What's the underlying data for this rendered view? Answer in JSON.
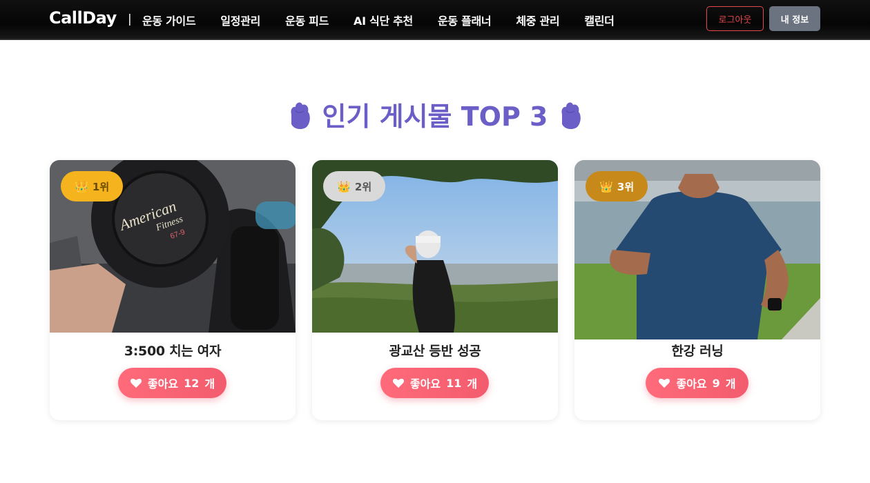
{
  "nav": {
    "brand": "CallDay",
    "separator": "|",
    "items": [
      "운동 가이드",
      "일정관리",
      "운동 피드",
      "AI 식단 추천",
      "운동 플래너",
      "체중 관리",
      "캘린더"
    ],
    "logout": "로그아웃",
    "my_info": "내 정보"
  },
  "section": {
    "title": "인기 게시물 TOP 3",
    "icon_left": "fist-icon",
    "icon_right": "fist-icon"
  },
  "posts": [
    {
      "rank": "1위",
      "badge_color": "#f5b41e",
      "badge_text_color": "#6b4b00",
      "title": "3:500 치는 여자",
      "like_label": "좋아요",
      "likes": "12",
      "like_unit": "개",
      "image": "dumbbell-photo"
    },
    {
      "rank": "2위",
      "badge_color": "#d9d9d9",
      "badge_text_color": "#555555",
      "title": "광교산 등반 성공",
      "like_label": "좋아요",
      "likes": "11",
      "like_unit": "개",
      "image": "mountain-photo"
    },
    {
      "rank": "3위",
      "badge_color": "#c8891b",
      "badge_text_color": "#ffffff",
      "title": "한강 러닝",
      "like_label": "좋아요",
      "likes": "9",
      "like_unit": "개",
      "image": "runner-photo"
    }
  ],
  "colors": {
    "accent": "#6b5fc7",
    "like": "#f25c6e",
    "logout": "#e5484d"
  }
}
